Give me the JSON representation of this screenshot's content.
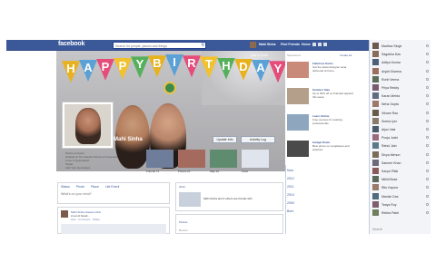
{
  "header": {
    "logo": "facebook",
    "search_placeholder": "Search for people, places and things",
    "user_label": "Mahi Sinha",
    "find_friends": "Find Friends",
    "home": "Home"
  },
  "cover": {
    "banner_letters": [
      "H",
      "A",
      "P",
      "P",
      "Y",
      "B",
      "I",
      "R",
      "T",
      "H",
      "D",
      "A",
      "Y"
    ],
    "banner_colors": [
      "#e8b21f",
      "#5aa1d6",
      "#e64c7a",
      "#f2c12e",
      "#56b05b",
      "#e8b21f",
      "#5aa1d6",
      "#e64c7a",
      "#f2c12e",
      "#56b05b",
      "#e8b21f",
      "#5aa1d6",
      "#e64c7a"
    ],
    "label": "Add a Cover"
  },
  "profile": {
    "name": "Mahi Sinha",
    "update_info": "Update Info",
    "activity_log": "Activity Log",
    "info_lines": [
      "Works at Fedex",
      "Studied at The Islands School of Computer",
      "Lives in Hyderabad",
      "Single",
      "Add Your Hometown"
    ],
    "thumbs": [
      {
        "label": "Friends 71",
        "color": "#6d7d9a"
      },
      {
        "label": "Photos 21",
        "color": "#a36a5d"
      },
      {
        "label": "Map 20",
        "color": "#5f8b6e"
      },
      {
        "label": "Likes",
        "color": "#e0e4ec"
      }
    ]
  },
  "composer": {
    "tabs": [
      "Status",
      "Photo",
      "Place",
      "Life Event"
    ],
    "placeholder": "What's on your mind?",
    "post_name": "Mahi Sinha shared a link",
    "post_line2": "A Lot of Good...",
    "post_line3": "Like · Comment · Share"
  },
  "timeline": {
    "entry1_title": "2012",
    "entry1_text": "Mahi Sinha and 2 others are friends with",
    "entry2_title": "Photos",
    "recent_label": "Recent"
  },
  "right_column": {
    "sponsored": "Sponsored",
    "create_ad": "Create Ad",
    "ads": [
      {
        "title": "Fabulous Kurtis",
        "text": "Get the latest designer wear delivered at home.",
        "color": "#c98a7a"
      },
      {
        "title": "Summer Sale",
        "text": "Up to 50% off on branded apparel this week.",
        "color": "#b4a08a"
      },
      {
        "title": "Learn Online",
        "text": "Free courses for working professionals.",
        "color": "#8fa6bf"
      },
      {
        "title": "Gadget Deals",
        "text": "Best prices on sunglasses and watches.",
        "color": "#4a4a4a"
      }
    ],
    "years": [
      "Now",
      "2012",
      "2011",
      "2010",
      "2009",
      "Born"
    ]
  },
  "sidebar": {
    "friends": [
      {
        "name": "Madhav Singh",
        "color": "#6b5a4e"
      },
      {
        "name": "Sagarika Das",
        "color": "#8a6c5a"
      },
      {
        "name": "Aditya Kumar",
        "color": "#4e5f7a"
      },
      {
        "name": "Anjali Sharma",
        "color": "#9b6e5f"
      },
      {
        "name": "Rohit Verma",
        "color": "#5a6e5a"
      },
      {
        "name": "Priya Reddy",
        "color": "#7a5a6e"
      },
      {
        "name": "Karan Mehta",
        "color": "#5e6a7e"
      },
      {
        "name": "Neha Gupta",
        "color": "#a0786a"
      },
      {
        "name": "Vikram Rao",
        "color": "#6a5a4a"
      },
      {
        "name": "Sneha Iyer",
        "color": "#8a7a6a"
      },
      {
        "name": "Arjun Nair",
        "color": "#4a5a6a"
      },
      {
        "name": "Pooja Joshi",
        "color": "#9a6a7a"
      },
      {
        "name": "Rahul Jain",
        "color": "#5a7a8a"
      },
      {
        "name": "Divya Menon",
        "color": "#7a6a5a"
      },
      {
        "name": "Sameer Khan",
        "color": "#6a6a7a"
      },
      {
        "name": "Kavya Pillai",
        "color": "#8a5a5a"
      },
      {
        "name": "Nikhil Bose",
        "color": "#5a6a5a"
      },
      {
        "name": "Ritu Kapoor",
        "color": "#9a7a6a"
      },
      {
        "name": "Manish Das",
        "color": "#4e6a7e"
      },
      {
        "name": "Tanya Roy",
        "color": "#7e5e6e"
      },
      {
        "name": "Rekha Patel",
        "color": "#6e7e5e"
      }
    ],
    "search_placeholder": "Search"
  }
}
